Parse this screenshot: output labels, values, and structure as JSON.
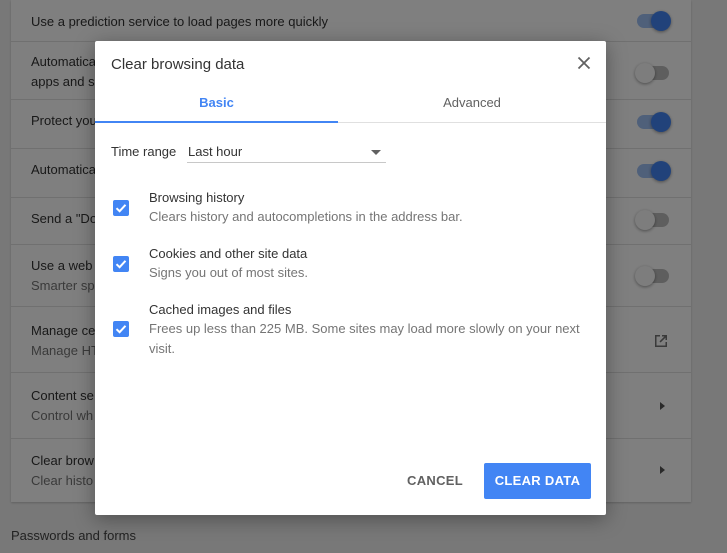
{
  "background": {
    "rows": [
      {
        "primary": "Use a prediction service to load pages more quickly",
        "secondary": "",
        "control": "toggle-on"
      },
      {
        "primary": "Automatica",
        "secondary": "apps and s",
        "control": "toggle-off"
      },
      {
        "primary": "Protect you",
        "secondary": "",
        "control": "toggle-on"
      },
      {
        "primary": "Automatica",
        "secondary": "",
        "control": "toggle-on"
      },
      {
        "primary": "Send a \"Do",
        "secondary": "",
        "control": "toggle-off"
      },
      {
        "primary": "Use a web",
        "secondary": "Smarter sp",
        "control": "toggle-off"
      },
      {
        "primary": "Manage ce",
        "secondary": "Manage HT",
        "control": "external-link"
      },
      {
        "primary": "Content se",
        "secondary": "Control wh",
        "control": "arrow"
      },
      {
        "primary": "Clear brow",
        "secondary": "Clear histo",
        "control": "arrow"
      }
    ],
    "section_title": "Passwords and forms"
  },
  "dialog": {
    "title": "Clear browsing data",
    "tabs": [
      {
        "label": "Basic",
        "selected": true
      },
      {
        "label": "Advanced",
        "selected": false
      }
    ],
    "time_range": {
      "label": "Time range",
      "value": "Last hour"
    },
    "options": [
      {
        "title": "Browsing history",
        "description": "Clears history and autocompletions in the address bar.",
        "checked": true
      },
      {
        "title": "Cookies and other site data",
        "description": "Signs you out of most sites.",
        "checked": true
      },
      {
        "title": "Cached images and files",
        "description": "Frees up less than 225 MB. Some sites may load more slowly on your next visit.",
        "checked": true
      }
    ],
    "cancel_label": "CANCEL",
    "confirm_label": "CLEAR DATA"
  },
  "colors": {
    "accent": "#4285f4",
    "scrim": "rgba(0,0,0,0.5)"
  }
}
